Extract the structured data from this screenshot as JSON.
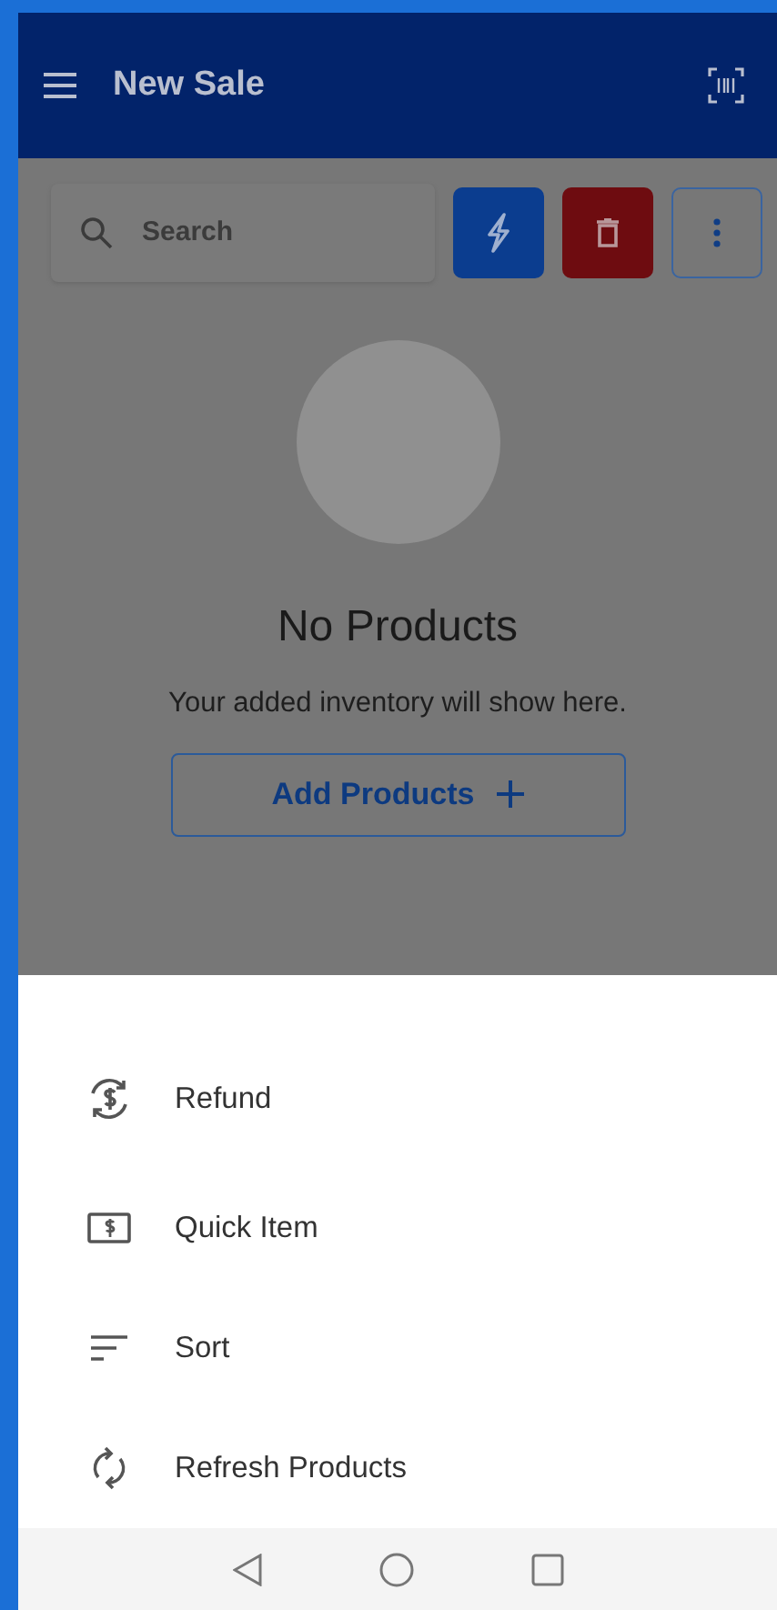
{
  "app_bar": {
    "title": "New Sale"
  },
  "toolbar": {
    "search": {
      "placeholder": "Search"
    }
  },
  "empty_state": {
    "title": "No Products",
    "message": "Your added inventory will show here.",
    "button": "Add Products"
  },
  "dimmed": true,
  "bottom_sheet": {
    "items": [
      {
        "kind": "refund",
        "label": "Refund"
      },
      {
        "kind": "quick_item",
        "label": "Quick Item"
      },
      {
        "kind": "sort",
        "label": "Sort"
      },
      {
        "kind": "refresh",
        "label": "Refresh Products"
      }
    ]
  }
}
